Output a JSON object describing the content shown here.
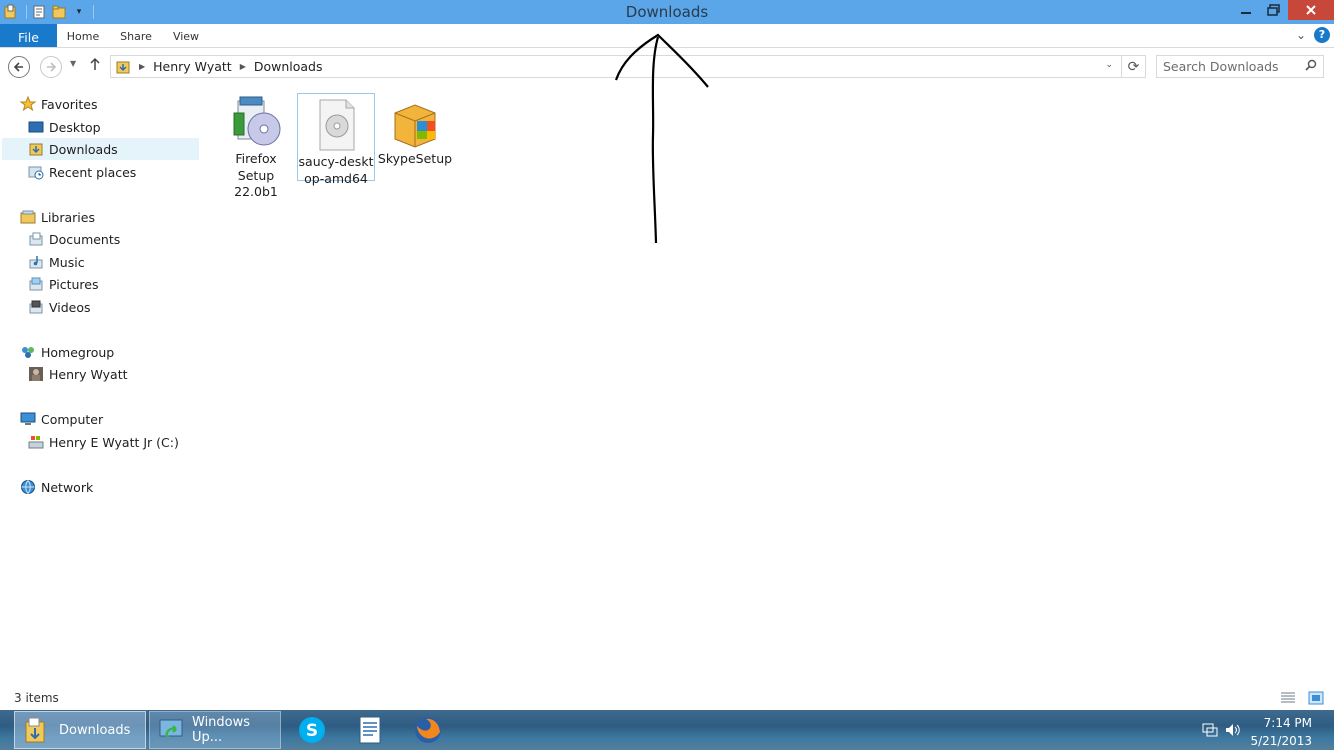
{
  "window": {
    "title": "Downloads"
  },
  "ribbon": {
    "tabs": [
      {
        "label": "File"
      },
      {
        "label": "Home"
      },
      {
        "label": "Share"
      },
      {
        "label": "View"
      }
    ]
  },
  "address": {
    "crumbs": [
      "Henry Wyatt",
      "Downloads"
    ],
    "search_placeholder": "Search Downloads"
  },
  "nav": {
    "favorites": "Favorites",
    "desktop": "Desktop",
    "downloads": "Downloads",
    "recent": "Recent places",
    "libraries": "Libraries",
    "documents": "Documents",
    "music": "Music",
    "pictures": "Pictures",
    "videos": "Videos",
    "homegroup": "Homegroup",
    "henry": "Henry Wyatt",
    "computer": "Computer",
    "cdrive": "Henry E Wyatt Jr (C:)",
    "network": "Network"
  },
  "files": [
    {
      "line1": "Firefox",
      "line2": "Setup",
      "line3": "22.0b1",
      "icon": "installer-disc-icon"
    },
    {
      "line1": "saucy-deskt",
      "line2": "op-amd64",
      "line3": "",
      "icon": "iso-disc-icon"
    },
    {
      "line1": "SkypeSetup",
      "line2": "",
      "line3": "",
      "icon": "setup-box-icon"
    }
  ],
  "status": {
    "item_count": "3 items"
  },
  "taskbar": {
    "downloads_label": "Downloads",
    "windows_update_label": "Windows Up...",
    "time": "7:14 PM",
    "date": "5/21/2013"
  },
  "colors": {
    "titlebar": "#5aa6e8",
    "file_tab": "#1979ca",
    "close_button": "#c7473a",
    "selection": "#e5f3fb"
  }
}
